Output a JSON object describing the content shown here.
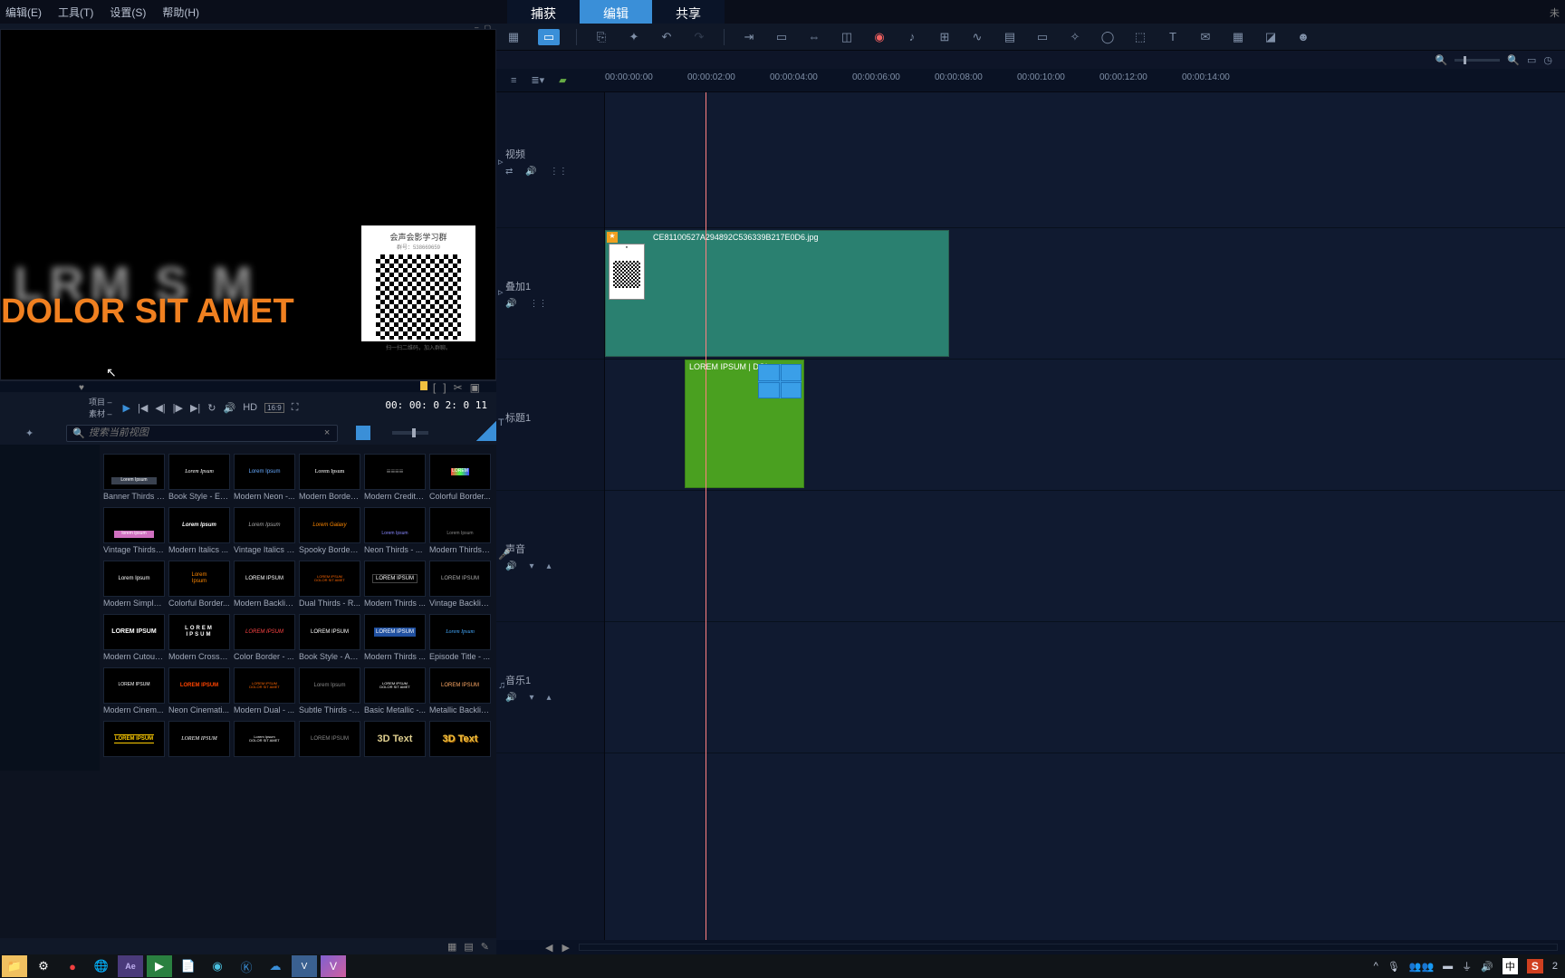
{
  "menubar": [
    "编辑(E)",
    "工具(T)",
    "设置(S)",
    "帮助(H)"
  ],
  "top_tabs": {
    "capture": "捕获",
    "edit": "编辑",
    "share": "共享"
  },
  "preview": {
    "blur": "LRM S M",
    "orange": "DOLOR SIT AMET",
    "qr_title": "会声会影学习群",
    "qr_sub": "群号：538669659",
    "qr_foot": "扫一扫二维码，加入群聊。"
  },
  "player": {
    "mode_top": "项目 –",
    "mode_bot": "素材 –",
    "hd": "HD",
    "ratio": "16:9",
    "timecode": "00: 00: 0 2: 0 11"
  },
  "library": {
    "search_ph": "搜索当前视图",
    "items": [
      {
        "label": "Banner Thirds - ...",
        "txt": "Lorem Ipsum",
        "style": "background:#3a4250;color:#fff;font-size:5px;padding:1px 10px;margin-top:20px"
      },
      {
        "label": "Book Style - Ex...",
        "txt": "Lorem Ipsum",
        "style": "font-style:italic;font-family:serif"
      },
      {
        "label": "Modern Neon -...",
        "txt": "Lorem Ipsum",
        "style": "color:#6af"
      },
      {
        "label": "Modern Border ...",
        "txt": "Lorem Ipsum",
        "style": "font-family:serif"
      },
      {
        "label": "Modern Credits...",
        "txt": "≡≡≡≡",
        "style": "font-size:8px;color:#888"
      },
      {
        "label": "Colorful Border...",
        "txt": "LOREM",
        "style": "background:linear-gradient(90deg,#f44,#4f4,#44f);font-size:5px;padding:1px"
      },
      {
        "label": "Vintage Thirds -...",
        "txt": "lorem ipsum",
        "style": "background:#d070c0;font-size:5px;padding:1px 8px;margin-top:20px"
      },
      {
        "label": "Modern Italics ...",
        "txt": "Lorem Ipsum",
        "style": "font-style:italic;font-weight:bold"
      },
      {
        "label": "Vintage Italics -...",
        "txt": "Lorem Ipsum",
        "style": "font-style:italic;color:#aaa"
      },
      {
        "label": "Spooky Border ...",
        "txt": "Lorem Galaxy",
        "style": "color:#f80;font-style:italic"
      },
      {
        "label": "Neon Thirds - ...",
        "txt": "Lorem Ipsum",
        "style": "color:#88f;font-size:5px;margin-top:20px"
      },
      {
        "label": "Modern Thirds -...",
        "txt": "Lorem Ipsum",
        "style": "color:#888;font-size:5px;margin-top:20px"
      },
      {
        "label": "Modern Simple...",
        "txt": "Lorem Ipsum",
        "style": ""
      },
      {
        "label": "Colorful Border...",
        "txt": "Lorem\\nIpsum",
        "style": "color:#f80"
      },
      {
        "label": "Modern Backlig...",
        "txt": "LOREM IPSUM",
        "style": ""
      },
      {
        "label": "Dual Thirds - R...",
        "txt": "LOREM IPSUM\\nDOLOR SIT AMET",
        "style": "color:#f60;font-size:4px"
      },
      {
        "label": "Modern Thirds ...",
        "txt": "LOREM IPSUM",
        "style": "border:1px solid #444;padding:1px 3px"
      },
      {
        "label": "Vintage Backlig...",
        "txt": "LOREM IPSUM",
        "style": "color:#aaa"
      },
      {
        "label": "Modern Cutout ...",
        "txt": "LOREM IPSUM",
        "style": "font-weight:bold;font-size:7px"
      },
      {
        "label": "Modern Crossw...",
        "txt": "LOREM\\nIPSUM",
        "style": "font-weight:bold;letter-spacing:2px"
      },
      {
        "label": "Color Border - ...",
        "txt": "LOREM IPSUM",
        "style": "color:#f44;font-style:italic"
      },
      {
        "label": "Book Style - Ap...",
        "txt": "LOREM IPSUM",
        "style": ""
      },
      {
        "label": "Modern Thirds ...",
        "txt": "LOREM IPSUM",
        "style": "background:#2050a0;padding:2px"
      },
      {
        "label": "Episode Title - ...",
        "txt": "Lorem Ipsum",
        "style": "color:#4af;font-style:italic;font-family:serif"
      },
      {
        "label": "Modern Cinem...",
        "txt": "LOREM IPSUM",
        "style": "font-size:5px"
      },
      {
        "label": "Neon Cinemati...",
        "txt": "LOREM IPSUM",
        "style": "color:#f40;font-weight:bold"
      },
      {
        "label": "Modern Dual - ...",
        "txt": "LOREM IPSUM\\nDOLOR SIT AMET",
        "style": "color:#f60;font-size:4px"
      },
      {
        "label": "Subtle Thirds - ...",
        "txt": "Lorem Ipsum",
        "style": "color:#888"
      },
      {
        "label": "Basic Metallic -...",
        "txt": "LOREM IPSUM\\nDOLOR SIT AMET",
        "style": "font-size:4px"
      },
      {
        "label": "Metallic Backlig...",
        "txt": "LOREM IPSUM",
        "style": "color:#fa6"
      },
      {
        "label": "",
        "txt": "LOREM IPSUM",
        "style": "color:#fc0;font-weight:bold;border-top:1px solid #fc0;border-bottom:1px solid #fc0;padding:1px"
      },
      {
        "label": "",
        "txt": "LOREM IPSUM",
        "style": "font-family:serif;font-style:italic"
      },
      {
        "label": "",
        "txt": "Lorem Ipsum\\nDOLOR SIT AMET",
        "style": "font-size:4px"
      },
      {
        "label": "",
        "txt": "LOREM IPSUM",
        "style": "color:#888"
      },
      {
        "label": "",
        "txt": "3D Text",
        "style": "font-size:11px;font-weight:bold;color:#e0d090;text-shadow:1px 1px #000"
      },
      {
        "label": "",
        "txt": "3D Text",
        "style": "font-size:11px;font-weight:bold;color:#f0c040;text-shadow:1px 1px #a06000"
      }
    ]
  },
  "timeline": {
    "ticks": [
      "00:00:00:00",
      "00:00:02:00",
      "00:00:04:00",
      "00:00:06:00",
      "00:00:08:00",
      "00:00:10:00",
      "00:00:12:00",
      "00:00:14:00"
    ],
    "tracks": {
      "video": "视频",
      "overlay": "叠加1",
      "title": "标题1",
      "voice": "声音",
      "music": "音乐1"
    },
    "clip_overlay_name": "CE81100527A294892C536339B217E0D6.jpg",
    "clip_title_name": "LOREM IPSUM | DOL"
  },
  "taskbar": {
    "ime": "中",
    "sogou": "S",
    "time_suffix": "2"
  }
}
